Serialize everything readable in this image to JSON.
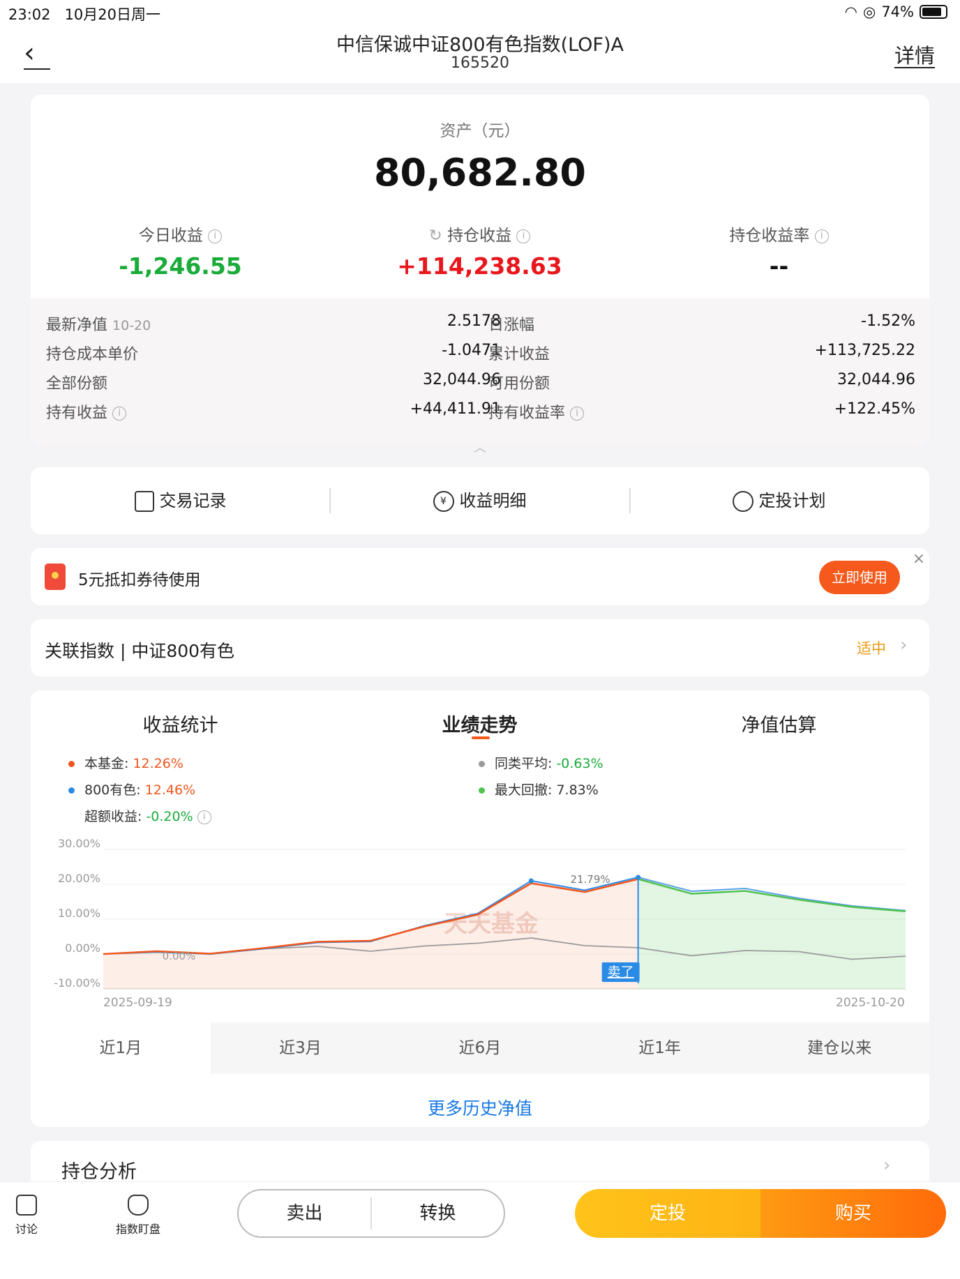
{
  "status": {
    "time": "23:02",
    "date": "10月20日周一",
    "battery": "74%"
  },
  "header": {
    "title": "中信保诚中证800有色指数(LOF)A",
    "code": "165520",
    "detail": "详情"
  },
  "asset": {
    "label": "资产（元）",
    "value": "80,682.80",
    "today_label": "今日收益",
    "today_value": "-1,246.55",
    "hold_label": "持仓收益",
    "hold_value": "+114,238.63",
    "rate_label": "持仓收益率",
    "rate_value": "--"
  },
  "details": [
    {
      "label": "最新净值",
      "sub": "10-20",
      "value": "2.5178",
      "label2": "日涨幅",
      "value2": "-1.52%"
    },
    {
      "label": "持仓成本单价",
      "sub": "",
      "value": "-1.0471",
      "label2": "累计收益",
      "value2": "+113,725.22"
    },
    {
      "label": "全部份额",
      "sub": "",
      "value": "32,044.96",
      "label2": "可用份额",
      "value2": "32,044.96"
    },
    {
      "label": "持有收益",
      "sub": "",
      "value": "+44,411.91",
      "label2": "持有收益率",
      "value2": "+122.45%"
    }
  ],
  "actions": {
    "trade": "交易记录",
    "profit": "收益明细",
    "plan": "定投计划",
    "yen": "¥"
  },
  "coupon": {
    "text": "5元抵扣券待使用",
    "button": "立即使用",
    "close": "×"
  },
  "index": {
    "text": "关联指数 | 中证800有色",
    "tag": "适中"
  },
  "chart_tabs": {
    "t1": "收益统计",
    "t2": "业绩走势",
    "t3": "净值估算"
  },
  "legend": {
    "fund_label": "本基金:",
    "fund_value": "12.26%",
    "idx_label": "800有色:",
    "idx_value": "12.46%",
    "excess_label": "超额收益:",
    "excess_value": "-0.20%",
    "peer_label": "同类平均:",
    "peer_value": "-0.63%",
    "dd_label": "最大回撤:",
    "dd_value": "7.83%"
  },
  "colors": {
    "fund": "#f0561e",
    "index": "#2a8be6",
    "peer": "#9a9a9a",
    "after": "#4fc24f",
    "accent": "#f55a1c"
  },
  "chart_data": {
    "type": "line",
    "y_ticks": [
      "30.00%",
      "20.00%",
      "10.00%",
      "0.00%",
      "-10.00%"
    ],
    "ylim": [
      -10,
      30
    ],
    "x_start": "2025-09-19",
    "x_end": "2025-10-20",
    "series": [
      {
        "name": "本基金",
        "values": [
          0,
          0.8,
          0.1,
          1.7,
          3.5,
          3.8,
          7.9,
          11.3,
          20.3,
          17.8,
          21.5,
          17.3,
          18.1,
          15.6,
          13.5,
          12.26
        ]
      },
      {
        "name": "800有色",
        "values": [
          0,
          0.6,
          0.0,
          1.5,
          3.3,
          3.6,
          8.1,
          11.6,
          21.0,
          18.3,
          22.0,
          18.0,
          18.8,
          16.0,
          13.8,
          12.46
        ]
      },
      {
        "name": "同类平均",
        "values": [
          0,
          0.5,
          0.0,
          1.5,
          2.2,
          0.8,
          2.3,
          3.1,
          4.6,
          2.4,
          1.8,
          -0.5,
          1.0,
          0.7,
          -1.5,
          -0.63
        ]
      }
    ],
    "peak_label": "21.79%",
    "start_label": "0.00%",
    "sell_label": "卖了",
    "sell_index": 10,
    "watermark": "天天基金",
    "ranges": [
      "近1月",
      "近3月",
      "近6月",
      "近1年",
      "建仓以来"
    ],
    "active_range": 0
  },
  "more_history": "更多历史净值",
  "holding": {
    "title": "持仓分析"
  },
  "bottom": {
    "discuss": "讨论",
    "monitor": "指数盯盘",
    "sell": "卖出",
    "switch": "转换",
    "fixed": "定投",
    "buy": "购买"
  }
}
